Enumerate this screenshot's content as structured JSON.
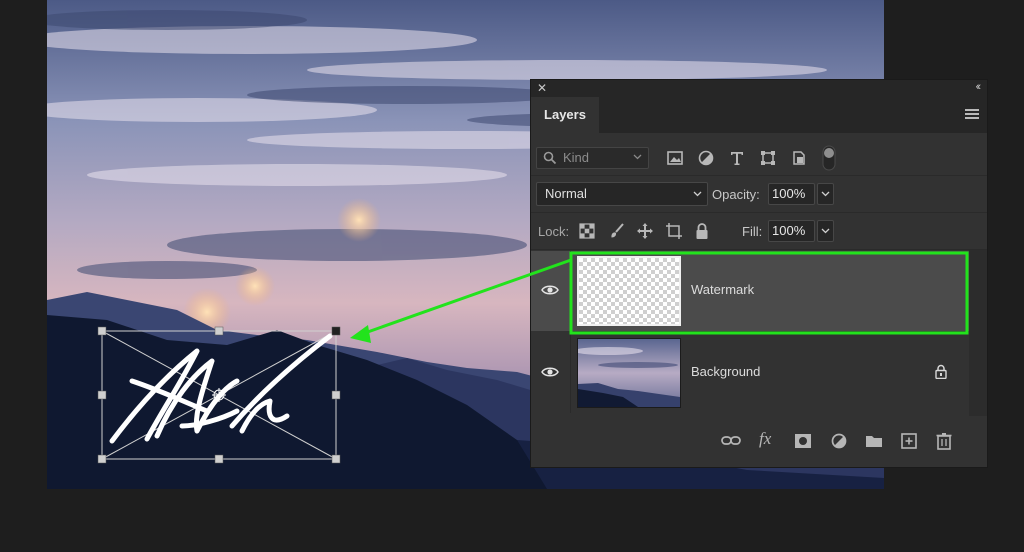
{
  "panel": {
    "close_glyph": "✕",
    "collapse_glyph": "‹‹",
    "tab_label": "Layers",
    "filter": {
      "placeholder": "Kind"
    },
    "blend_mode": "Normal",
    "opacity_label": "Opacity:",
    "opacity_value": "100%",
    "lock_label": "Lock:",
    "fill_label": "Fill:",
    "fill_value": "100%",
    "layers": [
      {
        "name": "Watermark",
        "visible": true,
        "locked": false,
        "selected": true
      },
      {
        "name": "Background",
        "visible": true,
        "locked": true,
        "selected": false
      }
    ],
    "footer_icons": [
      "link-icon",
      "fx-icon",
      "mask-icon",
      "adjustment-icon",
      "folder-icon",
      "new-layer-icon",
      "trash-icon"
    ],
    "fx_label": "fx"
  },
  "annotation": {
    "color": "#22e31c"
  },
  "colors": {
    "panel_bg": "#323232",
    "selected_row": "#4b4b4b",
    "accent": "#22e31c"
  }
}
